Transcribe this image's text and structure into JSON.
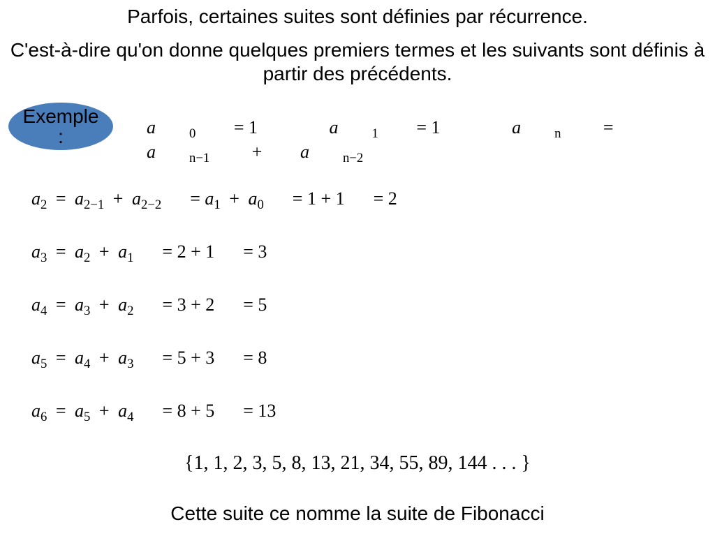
{
  "heading": {
    "line1": "Parfois, certaines suites sont définies par récurrence.",
    "line2": "C'est-à-dire qu'on donne quelques premiers termes et les suivants sont définis à partir des précédents."
  },
  "example_label_top": "Exemple",
  "example_label_bottom": ":",
  "defs": {
    "a0": "a",
    "a0_sub": "0",
    "a0_val": "= 1",
    "a1": "a",
    "a1_sub": "1",
    "a1_val": "= 1",
    "an": "a",
    "an_sub": "n",
    "eq": "=",
    "an1": "a",
    "an1_sub": "n−1",
    "plus": "+",
    "an2": "a",
    "an2_sub": "n−2"
  },
  "lines": {
    "l2": {
      "lhs_a": "a",
      "lhs_sub": "2",
      "eq1": "=",
      "t1a": "a",
      "t1s": "2−1",
      "p1": "+",
      "t2a": "a",
      "t2s": "2−2",
      "eq2": "=",
      "t3a": "a",
      "t3s": "1",
      "p2": "+",
      "t4a": "a",
      "t4s": "0",
      "eq3": "= 1 + 1",
      "eq4": "= 2"
    },
    "l3": {
      "lhs_a": "a",
      "lhs_sub": "3",
      "eq1": "=",
      "t1a": "a",
      "t1s": "2",
      "p1": "+",
      "t2a": "a",
      "t2s": "1",
      "eq2": "= 2 + 1",
      "eq3": "= 3"
    },
    "l4": {
      "lhs_a": "a",
      "lhs_sub": "4",
      "eq1": "=",
      "t1a": "a",
      "t1s": "3",
      "p1": "+",
      "t2a": "a",
      "t2s": "2",
      "eq2": "= 3 + 2",
      "eq3": "= 5"
    },
    "l5": {
      "lhs_a": "a",
      "lhs_sub": "5",
      "eq1": "=",
      "t1a": "a",
      "t1s": "4",
      "p1": "+",
      "t2a": "a",
      "t2s": "3",
      "eq2": "= 5 + 3",
      "eq3": "= 8"
    },
    "l6": {
      "lhs_a": "a",
      "lhs_sub": "6",
      "eq1": "=",
      "t1a": "a",
      "t1s": "5",
      "p1": "+",
      "t2a": "a",
      "t2s": "4",
      "eq2": "= 8 + 5",
      "eq3": "= 13"
    }
  },
  "sequence": "{1, 1, 2, 3, 5, 8, 13, 21, 34, 55, 89, 144 . . . }",
  "footer": "Cette suite ce nomme la suite de Fibonacci"
}
